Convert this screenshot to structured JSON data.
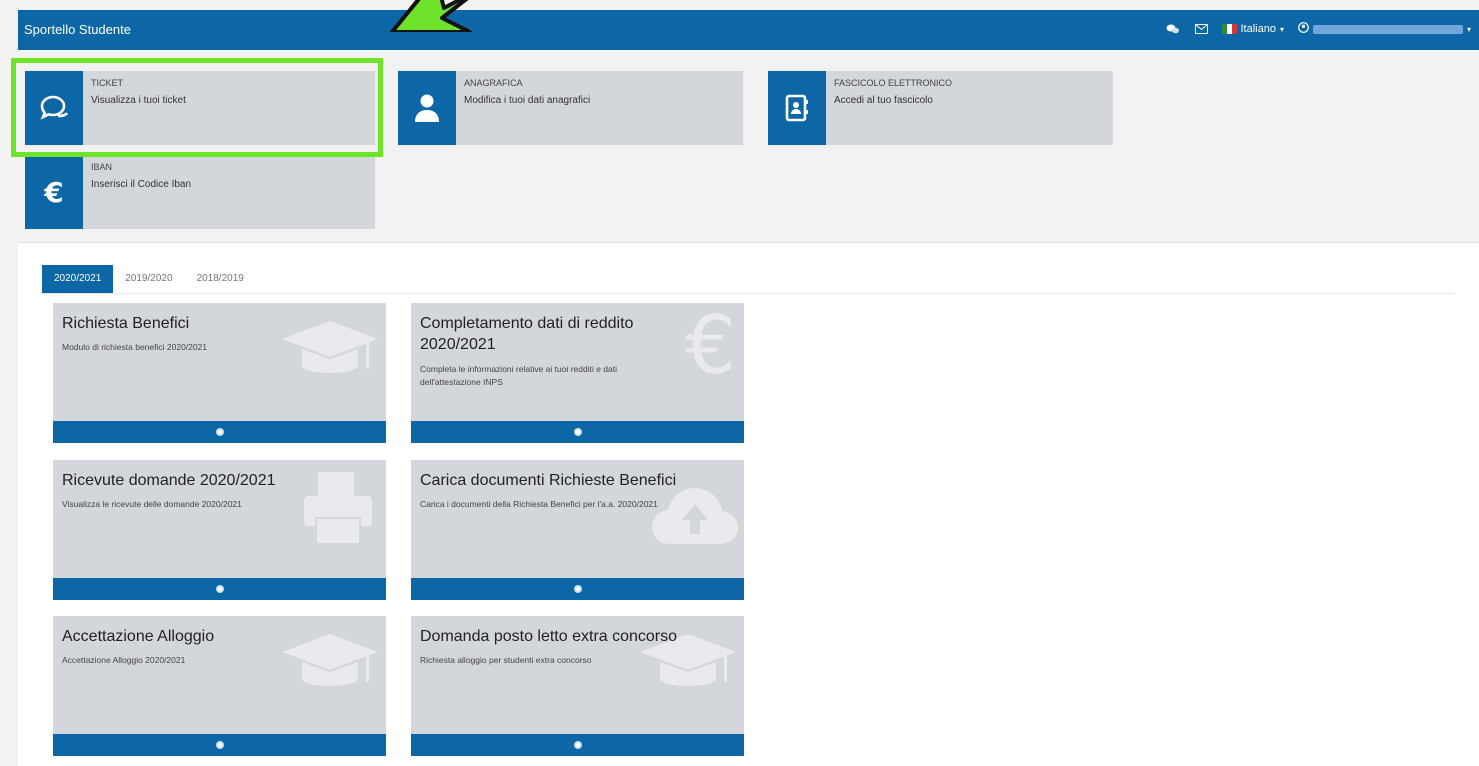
{
  "header": {
    "brand": "Sportello Studente",
    "language": "Italiano",
    "icons": [
      "chat-icon",
      "mail-icon",
      "user-icon"
    ],
    "accent_color": "#0d67a6"
  },
  "shortcuts": [
    {
      "title": "TICKET",
      "desc": "Visualizza i tuoi ticket",
      "icon": "chat-icon"
    },
    {
      "title": "ANAGRAFICA",
      "desc": "Modifica i tuoi dati anagrafici",
      "icon": "user-icon"
    },
    {
      "title": "FASCICOLO ELETTRONICO",
      "desc": "Accedi al tuo fascicolo",
      "icon": "address-book-icon"
    },
    {
      "title": "IBAN",
      "desc": "Inserisci il Codice Iban",
      "icon": "euro-icon"
    }
  ],
  "tabs": [
    "2020/2021",
    "2019/2020",
    "2018/2019"
  ],
  "active_tab": "2020/2021",
  "cards": [
    {
      "title": "Richiesta Benefici",
      "desc": "Modulo di richiesta benefici 2020/2021",
      "icon": "graduation-cap-icon"
    },
    {
      "title": "Completamento dati di reddito 2020/2021",
      "desc": "Completa le informazioni relative ai tuoi redditi e dati dell'attestazione INPS",
      "icon": "euro-icon"
    },
    {
      "title": "Ricevute domande 2020/2021",
      "desc": "Visualizza le ricevute delle domande 2020/2021",
      "icon": "printer-icon"
    },
    {
      "title": "Carica documenti Richieste Benefici",
      "desc": "Carica i documenti della Richiesta Benefici per l'a.a. 2020/2021",
      "icon": "cloud-upload-icon"
    },
    {
      "title": "Accettazione Alloggio",
      "desc": "Accettazione Alloggio 2020/2021",
      "icon": "graduation-cap-icon"
    },
    {
      "title": "Domanda posto letto extra concorso",
      "desc": "Richiesta alloggio per studenti extra concorso",
      "icon": "graduation-cap-icon"
    }
  ],
  "highlight_color": "#6fe32a"
}
